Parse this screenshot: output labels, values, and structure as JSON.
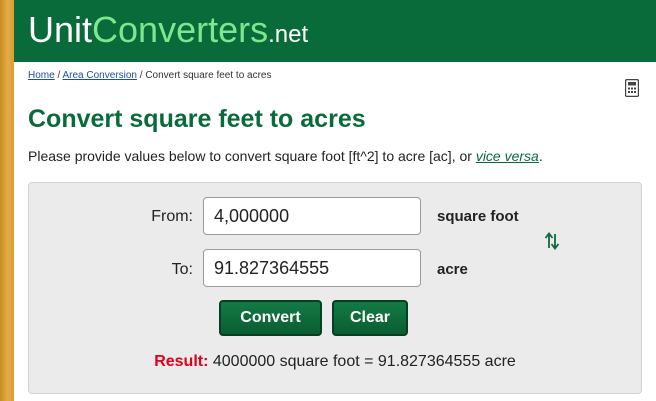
{
  "header": {
    "logo_part1": "Unit",
    "logo_part2": "Converters",
    "logo_part3": ".net"
  },
  "breadcrumb": {
    "home": "Home",
    "sep1": " / ",
    "category": "Area Conversion",
    "sep2": " / ",
    "current": "Convert square feet to acres"
  },
  "page": {
    "title": "Convert square feet to acres",
    "intro_text": "Please provide values below to convert square foot [ft^2] to acre [ac], or ",
    "intro_link": "vice versa",
    "intro_end": "."
  },
  "converter": {
    "from_label": "From:",
    "from_value": "4,000000",
    "from_unit": "square foot",
    "to_label": "To:",
    "to_value": "91.827364555",
    "to_unit": "acre",
    "convert_button": "Convert",
    "clear_button": "Clear",
    "result_label": "Result:",
    "result_text": " 4000000 square foot = 91.827364555 acre"
  },
  "colors": {
    "brand_green": "#0a6b3a",
    "logo_accent": "#7fe68f",
    "result_red": "#e0001a"
  },
  "icons": {
    "calculator": "calculator-icon",
    "swap": "swap-arrows-icon"
  }
}
